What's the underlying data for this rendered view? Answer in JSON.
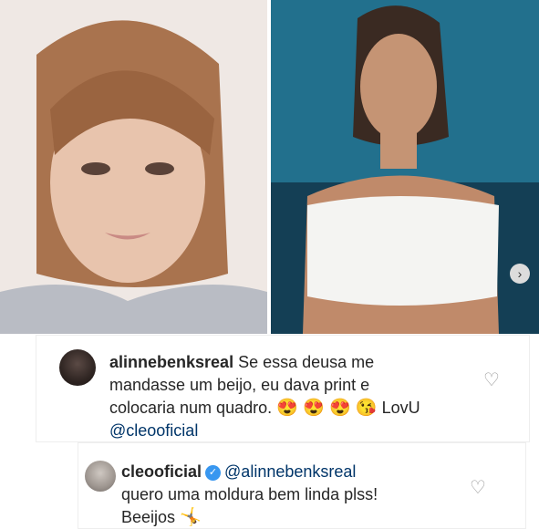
{
  "carousel": {
    "next_icon": "›"
  },
  "comments": [
    {
      "username": "alinnebenksreal",
      "text_line1": "Se essa deusa me",
      "text_line2": "mandasse um beijo, eu dava print e",
      "text_line3": "colocaria num quadro.",
      "emojis": "😍 😍 😍 😘",
      "sign_off": "LovU",
      "mention": "@cleooficial"
    },
    {
      "username": "cleooficial",
      "verified": true,
      "mention": "@alinnebenksreal",
      "text_line1": "quero uma moldura bem linda plss!",
      "text_line2": "Beeijos",
      "emoji": "🤸"
    }
  ],
  "icons": {
    "heart": "♡",
    "verified": "✓"
  }
}
